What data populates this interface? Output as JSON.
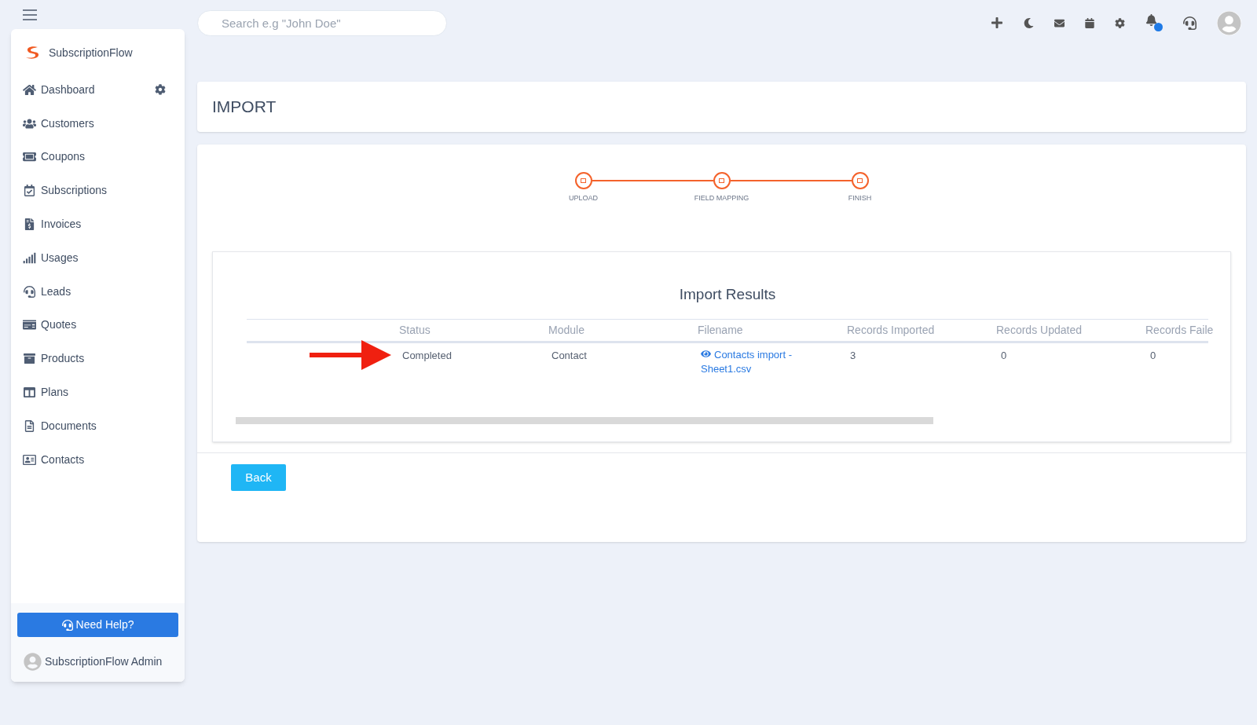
{
  "topbar": {
    "search": {
      "placeholder": "Search e.g \"John Doe\""
    }
  },
  "sidebar": {
    "brand": "SubscriptionFlow",
    "items": [
      {
        "label": "Dashboard"
      },
      {
        "label": "Customers"
      },
      {
        "label": "Coupons"
      },
      {
        "label": "Subscriptions"
      },
      {
        "label": "Invoices"
      },
      {
        "label": "Usages"
      },
      {
        "label": "Leads"
      },
      {
        "label": "Quotes"
      },
      {
        "label": "Products"
      },
      {
        "label": "Plans"
      },
      {
        "label": "Documents"
      },
      {
        "label": "Contacts"
      }
    ],
    "help_button": "Need Help?",
    "user": "SubscriptionFlow Admin"
  },
  "page_title": "IMPORT",
  "steps": [
    {
      "label": "UPLOAD"
    },
    {
      "label": "FIELD MAPPING"
    },
    {
      "label": "FINISH"
    }
  ],
  "results": {
    "title": "Import Results",
    "columns": [
      "",
      "Status",
      "Module",
      "Filename",
      "Records Imported",
      "Records Updated",
      "Records Faile"
    ],
    "rows": [
      {
        "status": "Completed",
        "module": "Contact",
        "filename": "Contacts import - Sheet1.csv",
        "imported": "3",
        "updated": "0",
        "failed": "0"
      }
    ]
  },
  "back_button": "Back"
}
